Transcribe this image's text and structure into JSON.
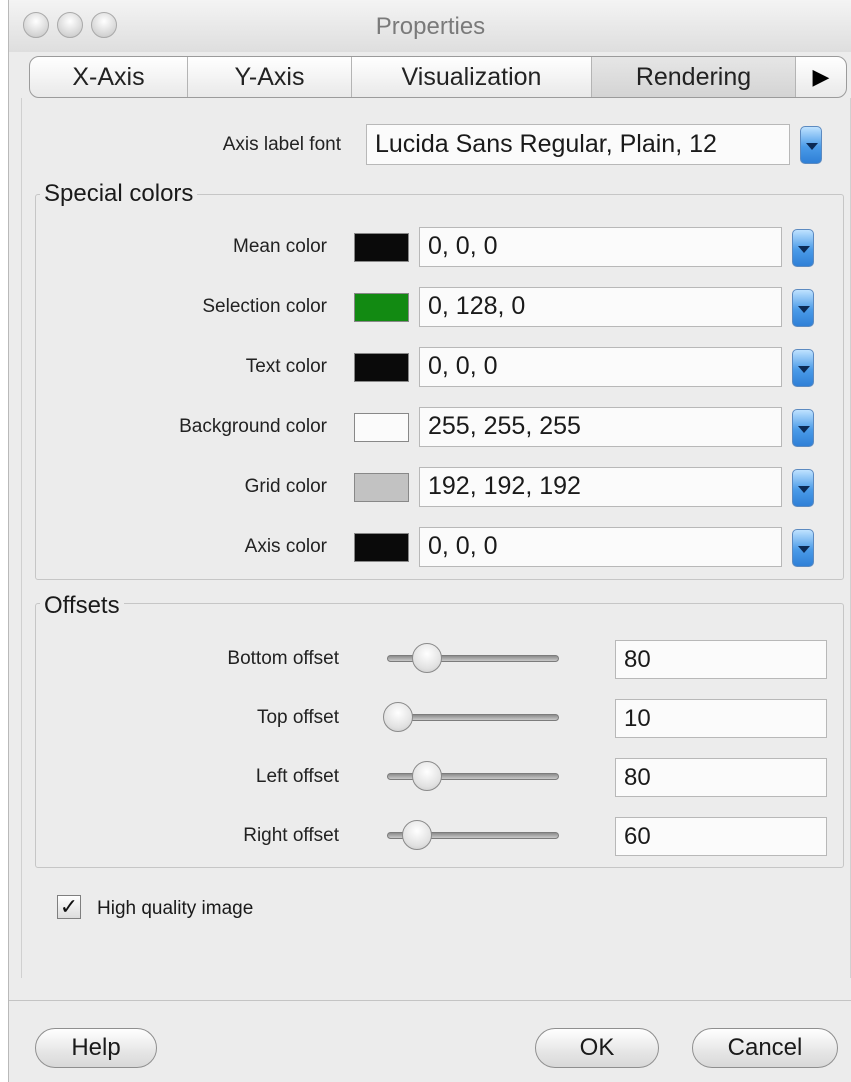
{
  "window": {
    "title": "Properties"
  },
  "tabs": [
    "X-Axis",
    "Y-Axis",
    "Visualization",
    "Rendering"
  ],
  "tab_more": "▶",
  "axis_font": {
    "label": "Axis label font",
    "value": "Lucida Sans Regular, Plain, 12"
  },
  "special_colors": {
    "title": "Special colors",
    "items": [
      {
        "label": "Mean color",
        "value": "0, 0, 0",
        "swatch": "#0a0a0a"
      },
      {
        "label": "Selection color",
        "value": "0, 128, 0",
        "swatch": "#128a12"
      },
      {
        "label": "Text color",
        "value": "0, 0, 0",
        "swatch": "#0a0a0a"
      },
      {
        "label": "Background color",
        "value": "255, 255, 255",
        "swatch": "#fbfbfb"
      },
      {
        "label": "Grid color",
        "value": "192, 192, 192",
        "swatch": "#c2c2c2"
      },
      {
        "label": "Axis color",
        "value": "0, 0, 0",
        "swatch": "#0a0a0a"
      }
    ]
  },
  "offsets": {
    "title": "Offsets",
    "items": [
      {
        "label": "Bottom offset",
        "value": "80"
      },
      {
        "label": "Top offset",
        "value": "10"
      },
      {
        "label": "Left offset",
        "value": "80"
      },
      {
        "label": "Right offset",
        "value": "60"
      }
    ]
  },
  "high_quality": {
    "label": "High quality image",
    "checked": true,
    "mark": "✓"
  },
  "buttons": {
    "help": "Help",
    "ok": "OK",
    "cancel": "Cancel"
  }
}
